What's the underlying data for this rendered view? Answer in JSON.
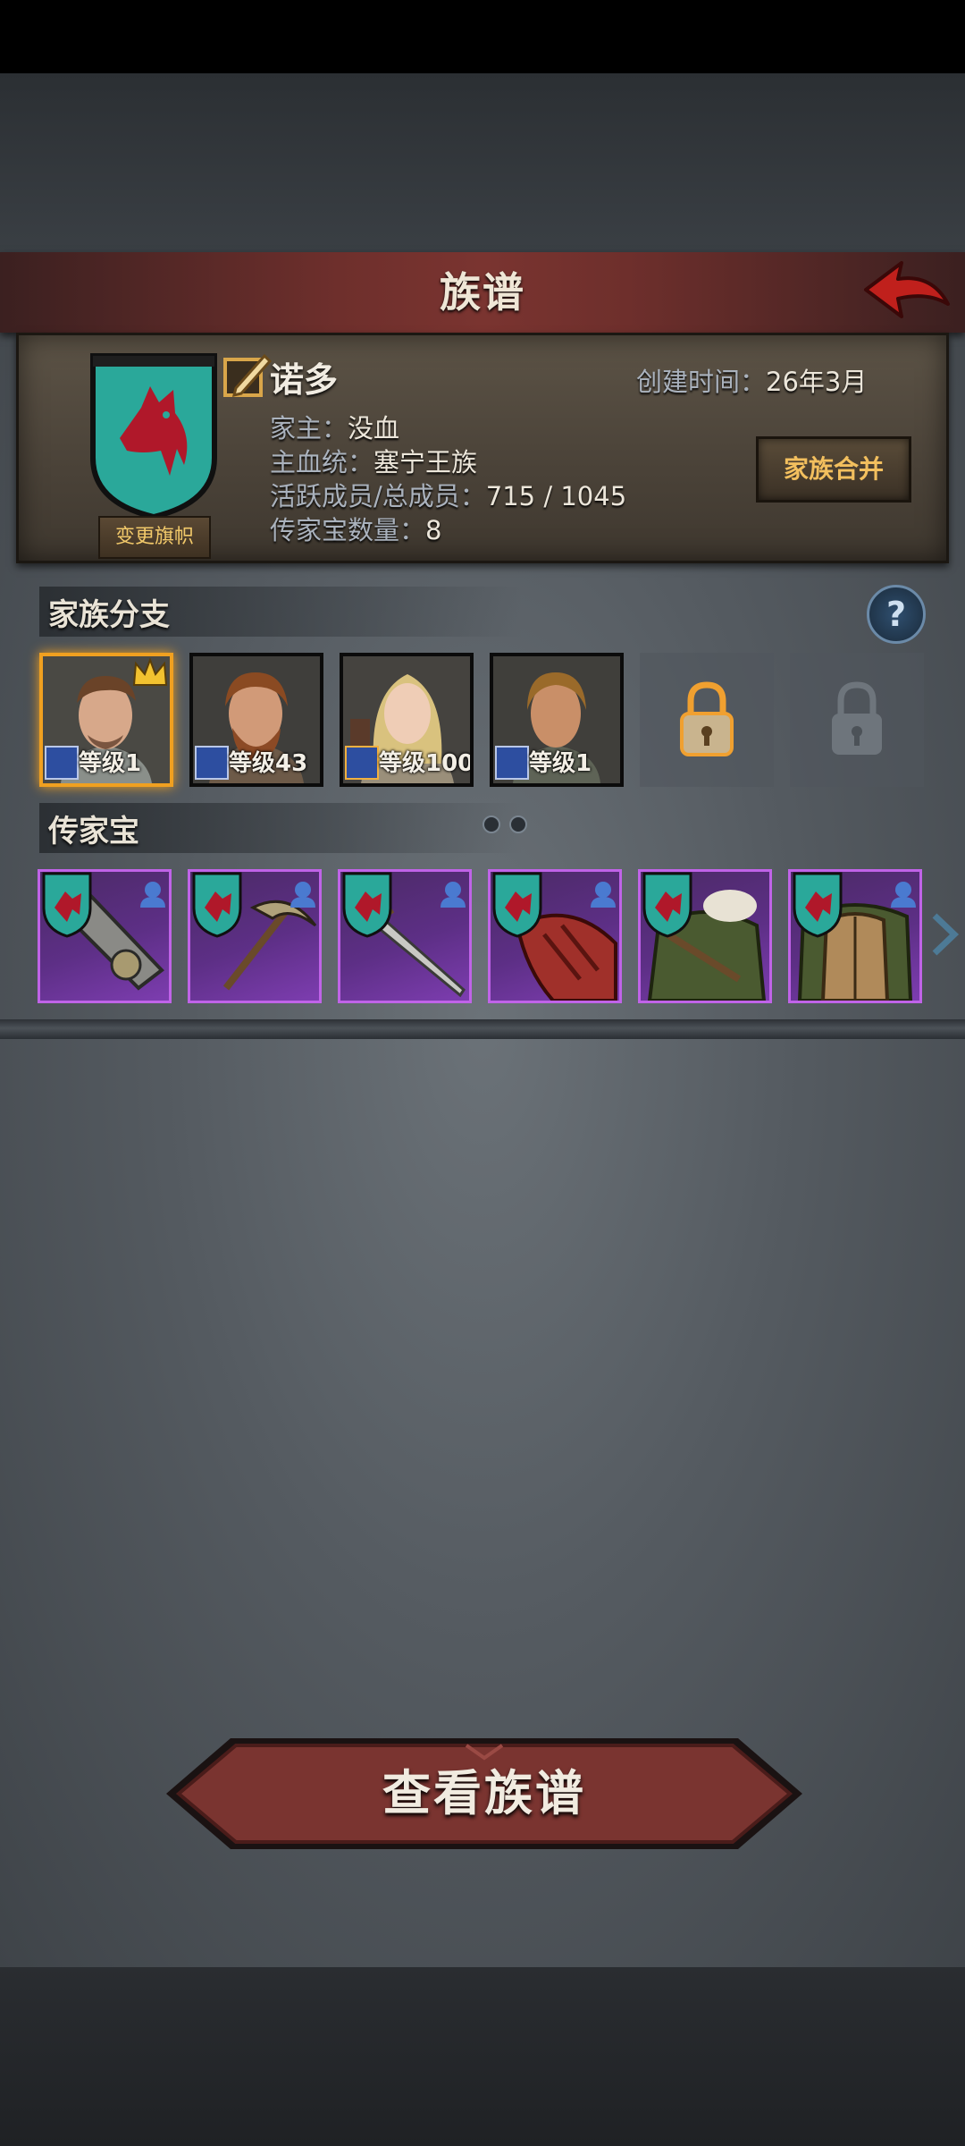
{
  "header": {
    "title": "族谱"
  },
  "family": {
    "name": "诺多",
    "change_banner_label": "变更旗帜",
    "created_label": "创建时间：",
    "created_value": "26年3月",
    "head_label": "家主：",
    "head_value": "没血",
    "bloodline_label": "主血统：",
    "bloodline_value": "塞宁王族",
    "members_label": "活跃成员/总成员：",
    "members_value": "715 / 1045",
    "heirloom_count_label": "传家宝数量：",
    "heirloom_count_value": "8",
    "merge_label": "家族合并"
  },
  "branches": {
    "title": "家族分支",
    "help_label": "?",
    "items": [
      {
        "level_text": "等级1",
        "selected": true
      },
      {
        "level_text": "等级43"
      },
      {
        "level_text": "等级100"
      },
      {
        "level_text": "等级1"
      }
    ]
  },
  "heirlooms": {
    "title": "传家宝",
    "items": [
      {
        "icon": "gauntlet-icon"
      },
      {
        "icon": "scythe-icon"
      },
      {
        "icon": "sword-icon"
      },
      {
        "icon": "red-gauntlet-icon"
      },
      {
        "icon": "fur-armor-icon"
      },
      {
        "icon": "plate-armor-icon"
      }
    ]
  },
  "actions": {
    "view_genealogy": "查看族谱"
  },
  "colors": {
    "accent_red": "#7a3430",
    "rarity_purple": "#c063e8",
    "selected_gold": "#f0a020",
    "banner_teal": "#2aa89a"
  }
}
